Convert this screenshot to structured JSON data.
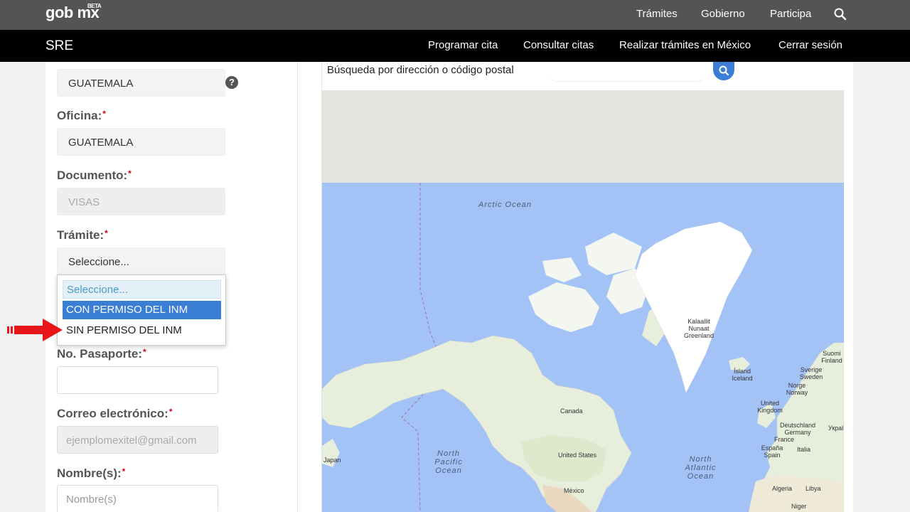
{
  "header": {
    "logo_main": "gob",
    "logo_mx": "mx",
    "logo_beta": "BETA",
    "nav": [
      "Trámites",
      "Gobierno",
      "Participa"
    ],
    "search_icon": "search-icon"
  },
  "subheader": {
    "title": "SRE",
    "nav": [
      "Programar cita",
      "Consultar citas",
      "Realizar trámites en México",
      "Cerrar sesión"
    ]
  },
  "form": {
    "pais_value": "GUATEMALA",
    "oficina_label": "Oficina:",
    "oficina_value": "GUATEMALA",
    "documento_label": "Documento:",
    "documento_value": "VISAS",
    "tramite_label": "Trámite:",
    "tramite_value": "Seleccione...",
    "tramite_options": [
      "Seleccione...",
      "CON PERMISO DEL INM",
      "SIN PERMISO DEL INM"
    ],
    "pasaporte_label": "No. Pasaporte:",
    "pasaporte_value": "",
    "correo_label": "Correo electrónico:",
    "correo_placeholder": "ejemplomexitel@gmail.com",
    "nombre_label": "Nombre(s):",
    "nombre_placeholder": "Nombre(s)",
    "required_mark": "*",
    "help_mark": "?"
  },
  "map": {
    "search_label": "Búsqueda por dirección o código postal",
    "oceans": [
      "Arctic Ocean",
      "North Pacific Ocean",
      "North Atlantic Ocean"
    ],
    "places": [
      "Kalaallit Nunaat Greenland",
      "Canada",
      "United States",
      "México",
      "Ísland Iceland",
      "Suomi Finland",
      "Sverige Sweden",
      "Norge Norway",
      "United Kingdom",
      "Deutschland Germany",
      "France",
      "España Spain",
      "Italia",
      "Україна",
      "Japan",
      "Algeria",
      "Libya",
      "Niger"
    ],
    "colors": {
      "water": "#a3c2f5",
      "land": "#e8eedc",
      "ice": "#ffffff"
    }
  }
}
